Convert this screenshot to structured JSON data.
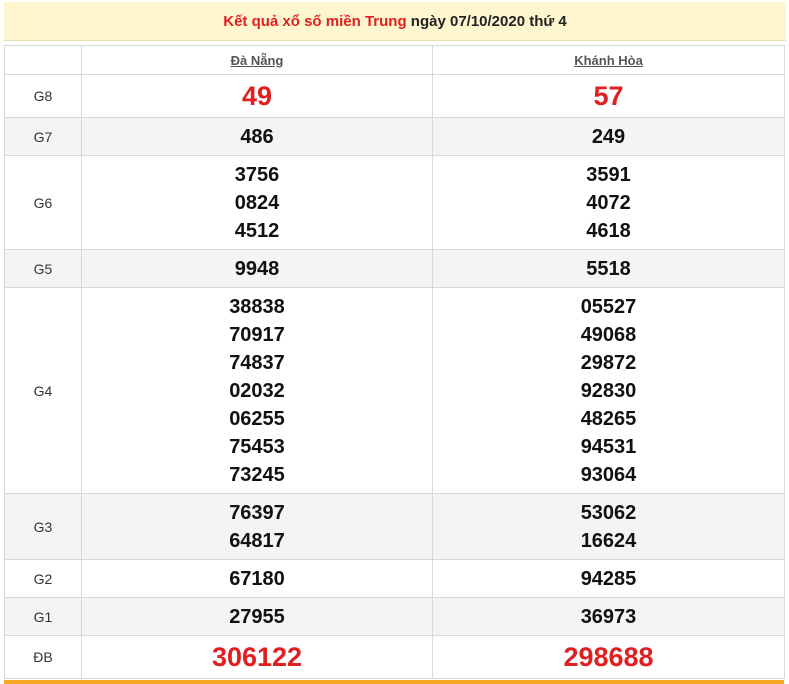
{
  "header": {
    "part1": "Kết quả xổ số miền",
    "region": "Trung",
    "part2": "ngày 07/10/2020 thứ 4"
  },
  "provinces": [
    "Đà Nẵng",
    "Khánh Hòa"
  ],
  "rows": [
    {
      "label": "G8",
      "a": [
        "49"
      ],
      "b": [
        "57"
      ]
    },
    {
      "label": "G7",
      "a": [
        "486"
      ],
      "b": [
        "249"
      ]
    },
    {
      "label": "G6",
      "a": [
        "3756",
        "0824",
        "4512"
      ],
      "b": [
        "3591",
        "4072",
        "4618"
      ]
    },
    {
      "label": "G5",
      "a": [
        "9948"
      ],
      "b": [
        "5518"
      ]
    },
    {
      "label": "G4",
      "a": [
        "38838",
        "70917",
        "74837",
        "02032",
        "06255",
        "75453",
        "73245"
      ],
      "b": [
        "05527",
        "49068",
        "29872",
        "92830",
        "48265",
        "94531",
        "93064"
      ]
    },
    {
      "label": "G3",
      "a": [
        "76397",
        "64817"
      ],
      "b": [
        "53062",
        "16624"
      ]
    },
    {
      "label": "G2",
      "a": [
        "67180"
      ],
      "b": [
        "94285"
      ]
    },
    {
      "label": "G1",
      "a": [
        "27955"
      ],
      "b": [
        "36973"
      ]
    },
    {
      "label": "ĐB",
      "a": [
        "306122"
      ],
      "b": [
        "298688"
      ]
    }
  ],
  "colors": {
    "highlight": "#e02020",
    "title_bg": "#fdf6cf",
    "bottom_bar": "#f5a623"
  }
}
